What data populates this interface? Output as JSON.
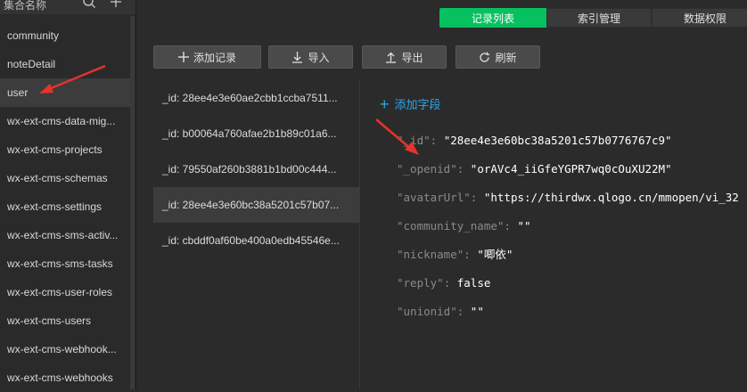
{
  "sidebar": {
    "title": "集合名称",
    "items": [
      {
        "label": "community"
      },
      {
        "label": "noteDetail"
      },
      {
        "label": "user"
      },
      {
        "label": "wx-ext-cms-data-mig..."
      },
      {
        "label": "wx-ext-cms-projects"
      },
      {
        "label": "wx-ext-cms-schemas"
      },
      {
        "label": "wx-ext-cms-settings"
      },
      {
        "label": "wx-ext-cms-sms-activ..."
      },
      {
        "label": "wx-ext-cms-sms-tasks"
      },
      {
        "label": "wx-ext-cms-user-roles"
      },
      {
        "label": "wx-ext-cms-users"
      },
      {
        "label": "wx-ext-cms-webhook..."
      },
      {
        "label": "wx-ext-cms-webhooks"
      }
    ],
    "active_index": 2
  },
  "tabs": [
    {
      "label": "记录列表"
    },
    {
      "label": "索引管理"
    },
    {
      "label": "数据权限"
    }
  ],
  "toolbar": {
    "add": "添加记录",
    "import": "导入",
    "export": "导出",
    "refresh": "刷新"
  },
  "records": [
    {
      "label": "_id: 28ee4e3e60ae2cbb1ccba7511..."
    },
    {
      "label": "_id: b00064a760afae2b1b89c01a6..."
    },
    {
      "label": "_id: 79550af260b3881b1bd00c444..."
    },
    {
      "label": "_id: 28ee4e3e60bc38a5201c57b07..."
    },
    {
      "label": "_id: cbddf0af60be400a0edb45546e..."
    }
  ],
  "active_record_index": 3,
  "detail": {
    "add_field": "添加字段",
    "fields": [
      {
        "key": "\"_id\"",
        "value": "\"28ee4e3e60bc38a5201c57b0776767c9\""
      },
      {
        "key": "\"_openid\"",
        "value": "\"orAVc4_iiGfeYGPR7wq0cOuXU22M\""
      },
      {
        "key": "\"avatarUrl\"",
        "value": "\"https://thirdwx.qlogo.cn/mmopen/vi_32"
      },
      {
        "key": "\"community_name\"",
        "value": "\"\""
      },
      {
        "key": "\"nickname\"",
        "value": "\"唧依\""
      },
      {
        "key": "\"reply\"",
        "value": "false"
      },
      {
        "key": "\"unionid\"",
        "value": "\"\""
      }
    ]
  },
  "colors": {
    "accent": "#07c160",
    "link": "#2aa7e8",
    "annotation_arrow": "#e5332d"
  },
  "icons": [
    "search-icon",
    "plus-icon",
    "download-icon",
    "upload-icon",
    "refresh-icon",
    "annotation-arrow"
  ]
}
